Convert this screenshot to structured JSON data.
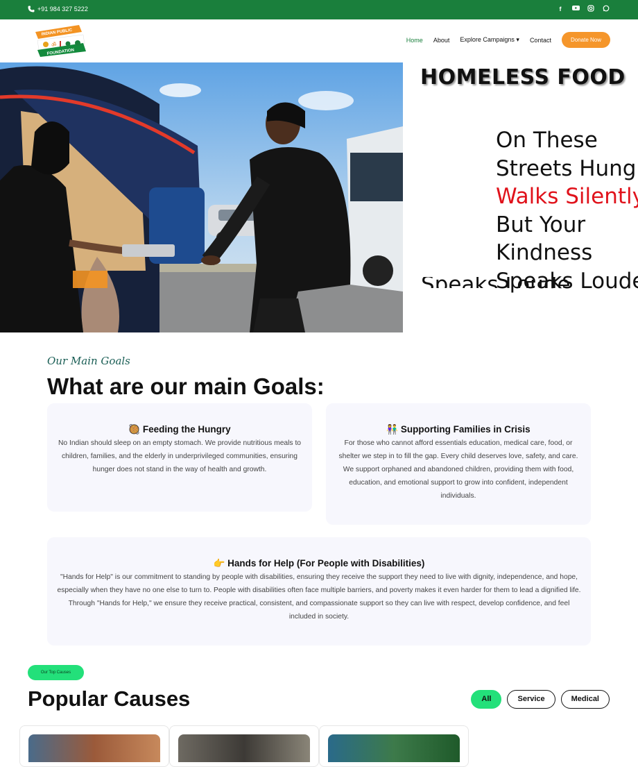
{
  "topbar": {
    "phone": "+91 984 327 5222",
    "social_icons": [
      "facebook-icon",
      "youtube-icon",
      "instagram-icon",
      "whatsapp-icon"
    ]
  },
  "logo": {
    "line1": "INDIAN PUBLIC",
    "line2": "FOUNDATION"
  },
  "nav": {
    "items": [
      "Home",
      "About",
      "Explore Campaigns",
      "Contact"
    ],
    "active": "Home",
    "donate": "Donate Now"
  },
  "hero": {
    "title": "HOMELESS FOOD",
    "verse": {
      "line1": "On These",
      "line2": "Streets Hung",
      "line3": "Walks Silently",
      "line4": "But Your",
      "line5": "Kindness",
      "line6": "Speaks Loude"
    },
    "ghost": "Speaks Loude"
  },
  "goals": {
    "script_label": "Our Main Goals",
    "title": "What are our main Goals:",
    "cards": [
      {
        "icon": "🥘",
        "title": "Feeding the Hungry",
        "text": "No Indian should sleep on an empty stomach. We provide nutritious meals to children, families, and the elderly in underprivileged communities, ensuring hunger does not stand in the way of health and growth."
      },
      {
        "icon": "👫",
        "title": "Supporting Families in Crisis",
        "text": "For those who cannot afford essentials education, medical care, food, or shelter we step in to fill the gap. Every child deserves love, safety, and care. We support orphaned and abandoned children, providing them with food, education, and emotional support to grow into confident, independent individuals."
      },
      {
        "icon": "👉",
        "title": "Hands for Help (For People with Disabilities)",
        "text": "\"Hands for Help\" is our commitment to standing by people with disabilities, ensuring they receive the support they need to live with dignity, independence, and hope, especially when they have no one else to turn to. People with disabilities often face multiple barriers, and poverty makes it even harder for them to lead a dignified life. Through \"Hands for Help,\" we ensure they receive practical, consistent, and compassionate support so they can live with respect, develop confidence, and feel included in society."
      }
    ]
  },
  "causes": {
    "pill": "Our Top Causes",
    "title": "Popular Causes",
    "filters": [
      "All",
      "Service",
      "Medical"
    ],
    "active_filter": "All"
  },
  "colors": {
    "brand_green": "#1a7f3c",
    "accent_orange": "#f5962b",
    "pill_green": "#23e07a",
    "verse_red": "#e0121b"
  }
}
